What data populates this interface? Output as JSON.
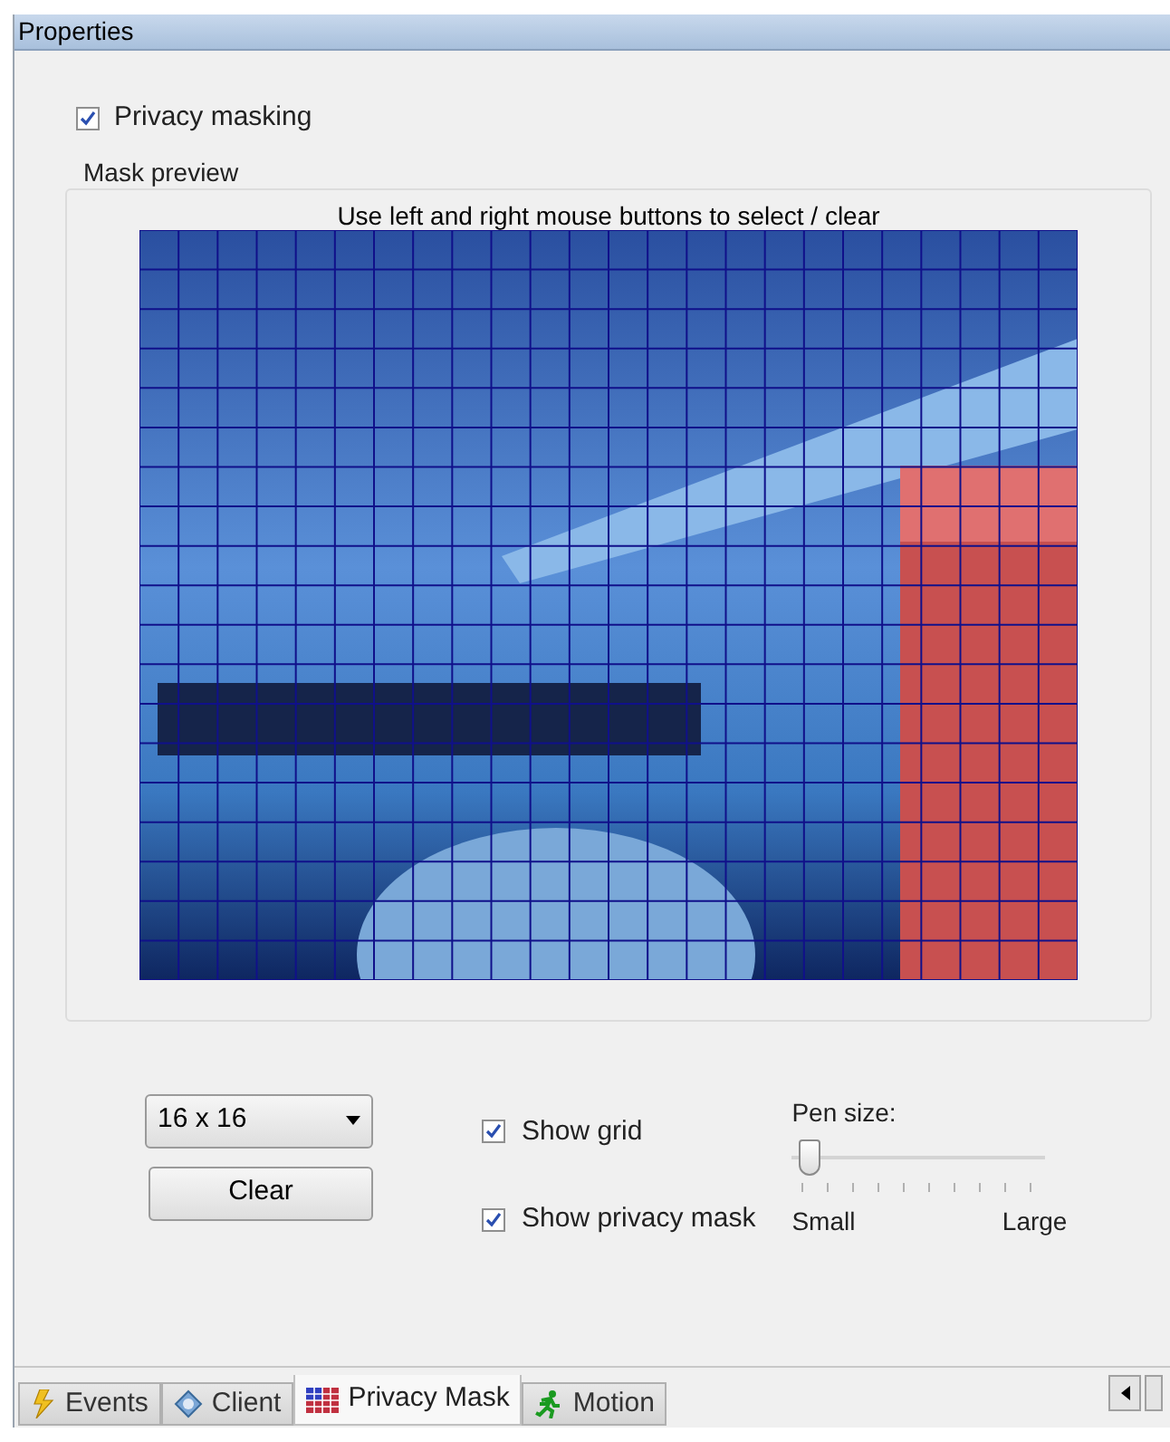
{
  "panel": {
    "title": "Properties"
  },
  "privacy_masking": {
    "label": "Privacy masking",
    "checked": true
  },
  "mask_preview": {
    "title": "Mask preview",
    "hint": "Use left and right mouse buttons to select / clear"
  },
  "grid_size": {
    "value": "16 x 16"
  },
  "clear_button": {
    "label": "Clear"
  },
  "options": [
    {
      "label": "Show grid",
      "checked": true
    },
    {
      "label": "Show privacy mask",
      "checked": true
    }
  ],
  "pen_size": {
    "label": "Pen size:",
    "level": 0.03,
    "min_label": "Small",
    "max_label": "Large"
  },
  "tabs": [
    {
      "label": "Events",
      "kind": "events",
      "selected": false
    },
    {
      "label": "Client",
      "kind": "client",
      "selected": false
    },
    {
      "label": "Privacy Mask",
      "kind": "mask",
      "selected": true
    },
    {
      "label": "Motion",
      "kind": "motion",
      "selected": false
    }
  ]
}
